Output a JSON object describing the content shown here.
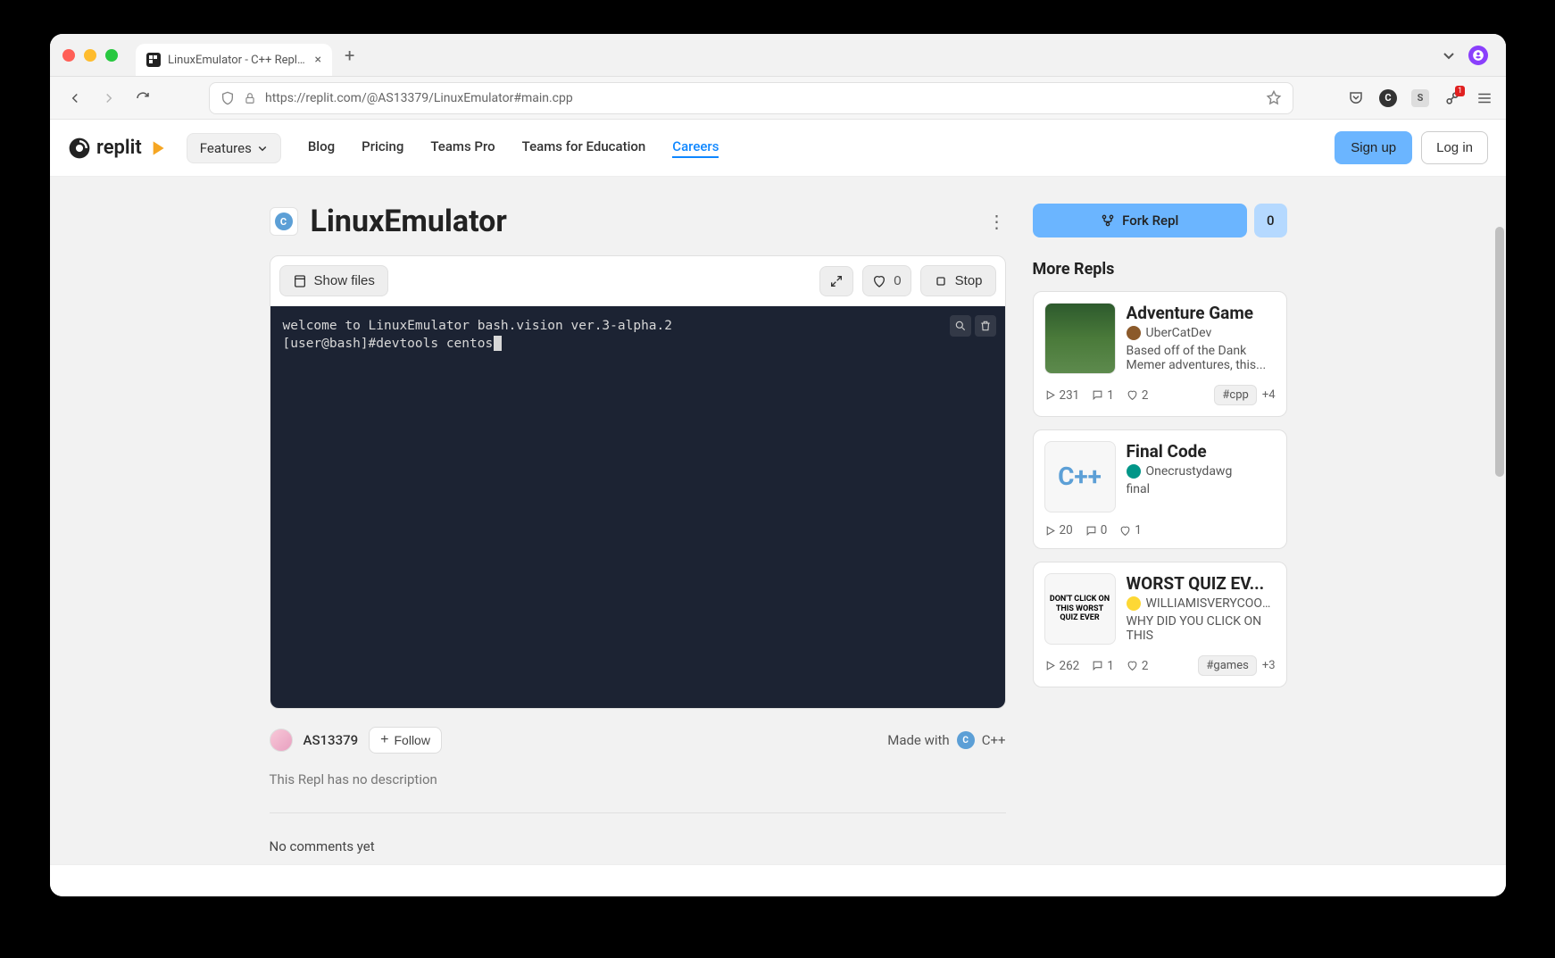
{
  "browser": {
    "tab_title": "LinuxEmulator - C++ Repl - Rep…",
    "url": "https://replit.com/@AS13379/LinuxEmulator#main.cpp"
  },
  "nav": {
    "features": "Features",
    "links": [
      "Blog",
      "Pricing",
      "Teams Pro",
      "Teams for Education",
      "Careers"
    ],
    "signup": "Sign up",
    "login": "Log in"
  },
  "repl": {
    "title": "LinuxEmulator",
    "show_files": "Show files",
    "like_count": "0",
    "stop": "Stop",
    "terminal_line1": "welcome to LinuxEmulator bash.vision ver.3-alpha.2",
    "terminal_line2": "[user@bash]#devtools centos",
    "author": "AS13379",
    "follow": "Follow",
    "made_with_label": "Made with",
    "language": "C++",
    "description": "This Repl has no description",
    "no_comments": "No comments yet"
  },
  "side": {
    "fork": "Fork Repl",
    "fork_count": "0",
    "more_label": "More Repls",
    "cards": [
      {
        "title": "Adventure Game",
        "author": "UberCatDev",
        "avatar_class": "brown",
        "thumb_class": "jungle",
        "thumb_text": "",
        "desc": "Based off of the Dank Memer adventures, this...",
        "runs": "231",
        "comments": "1",
        "likes": "2",
        "tag": "#cpp",
        "more": "+4"
      },
      {
        "title": "Final Code",
        "author": "Onecrustydawg",
        "avatar_class": "teal",
        "thumb_class": "cpp-icon",
        "thumb_text": "",
        "desc": "final",
        "runs": "20",
        "comments": "0",
        "likes": "1",
        "tag": "",
        "more": ""
      },
      {
        "title": "WORST QUIZ EV...",
        "author": "WILLIAMISVERYCOOL...",
        "avatar_class": "yellow",
        "thumb_class": "",
        "thumb_text": "DON'T CLICK ON THIS WORST QUIZ EVER",
        "desc": "WHY DID YOU CLICK ON THIS",
        "runs": "262",
        "comments": "1",
        "likes": "2",
        "tag": "#games",
        "more": "+3"
      }
    ]
  },
  "ext_badge": "1"
}
